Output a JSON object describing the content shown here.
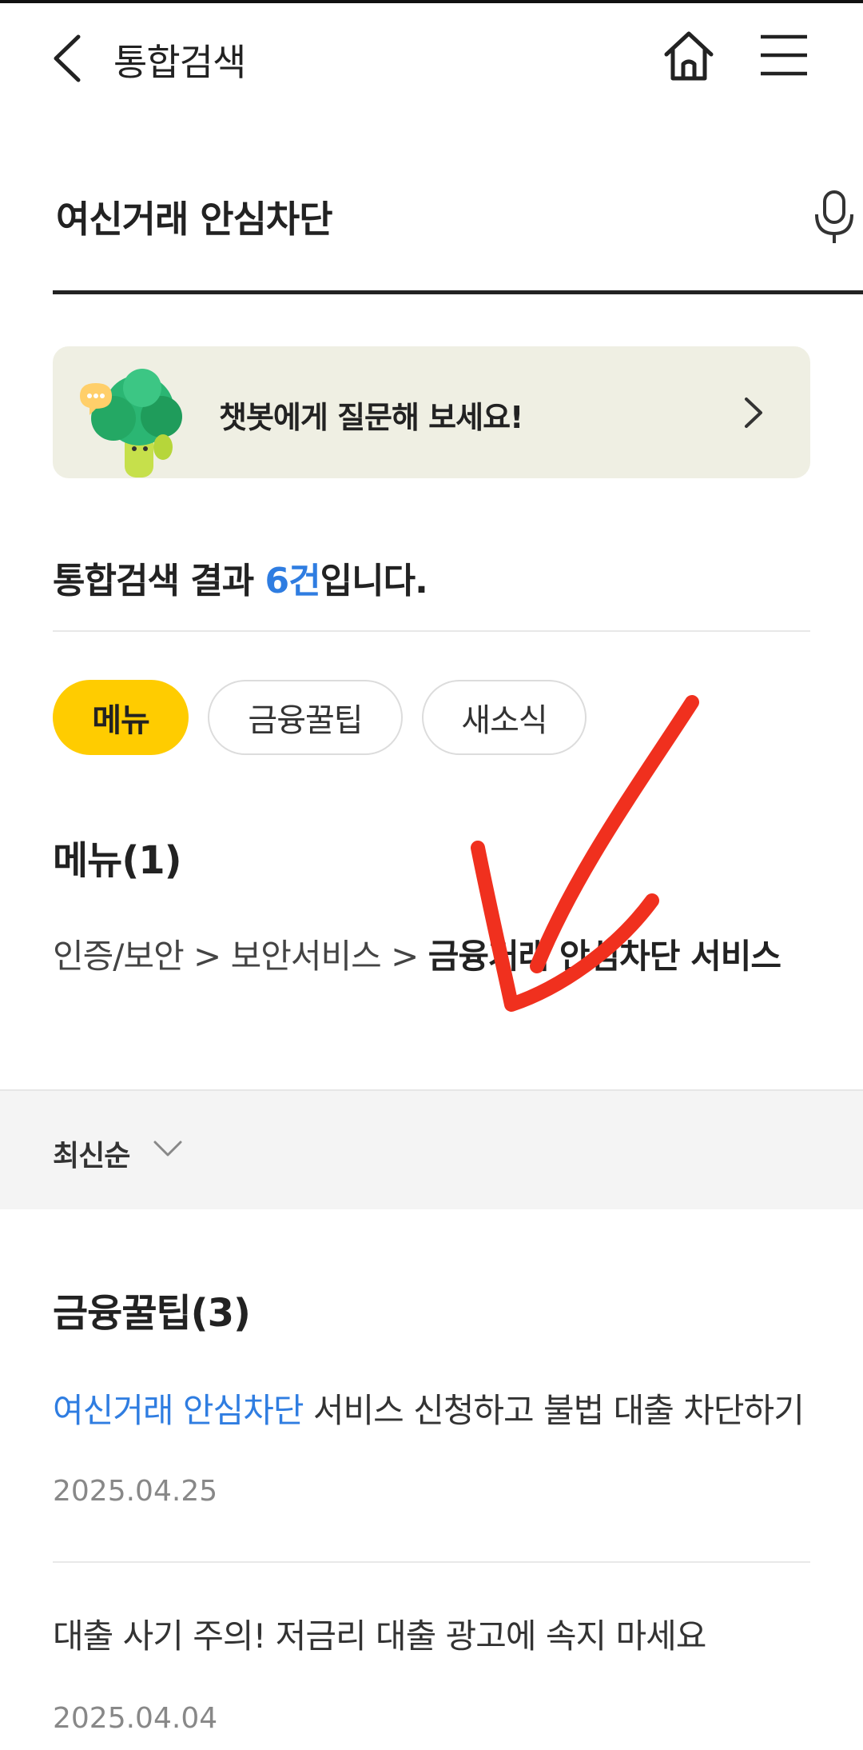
{
  "header": {
    "title": "통합검색",
    "back_icon": "chevron-left-icon",
    "home_icon": "home-icon",
    "menu_icon": "hamburger-menu-icon"
  },
  "search": {
    "query": "여신거래 안심차단",
    "mic_icon": "microphone-icon"
  },
  "chatbot_banner": {
    "text": "챗봇에게 질문해 보세요!",
    "character_icon": "tree-character-icon",
    "arrow_icon": "chevron-right-icon"
  },
  "results": {
    "prefix": "통합검색 결과 ",
    "count": "6건",
    "suffix": "입니다."
  },
  "chips": [
    {
      "label": "메뉴",
      "active": true
    },
    {
      "label": "금융꿀팁",
      "active": false
    },
    {
      "label": "새소식",
      "active": false
    }
  ],
  "menu_section": {
    "title": "메뉴(1)",
    "breadcrumb_path": "인증/보안 > 보안서비스 > ",
    "breadcrumb_target": "금융거래 안심차단 서비스"
  },
  "sort": {
    "label": "최신순",
    "icon": "chevron-down-icon"
  },
  "tips_section": {
    "title": "금융꿀팁(3)",
    "items": [
      {
        "highlight": "여신거래 안심차단",
        "rest": " 서비스 신청하고 불법 대출 차단하기",
        "date": "2025.04.25"
      },
      {
        "highlight": "",
        "rest": "대출 사기 주의! 저금리 대출 광고에 속지 마세요",
        "date": "2025.04.04"
      }
    ]
  },
  "colors": {
    "accent_yellow": "#ffcc00",
    "highlight_blue": "#2f7de1",
    "banner_bg": "#efefe3",
    "annotation_red": "#f0301e"
  }
}
